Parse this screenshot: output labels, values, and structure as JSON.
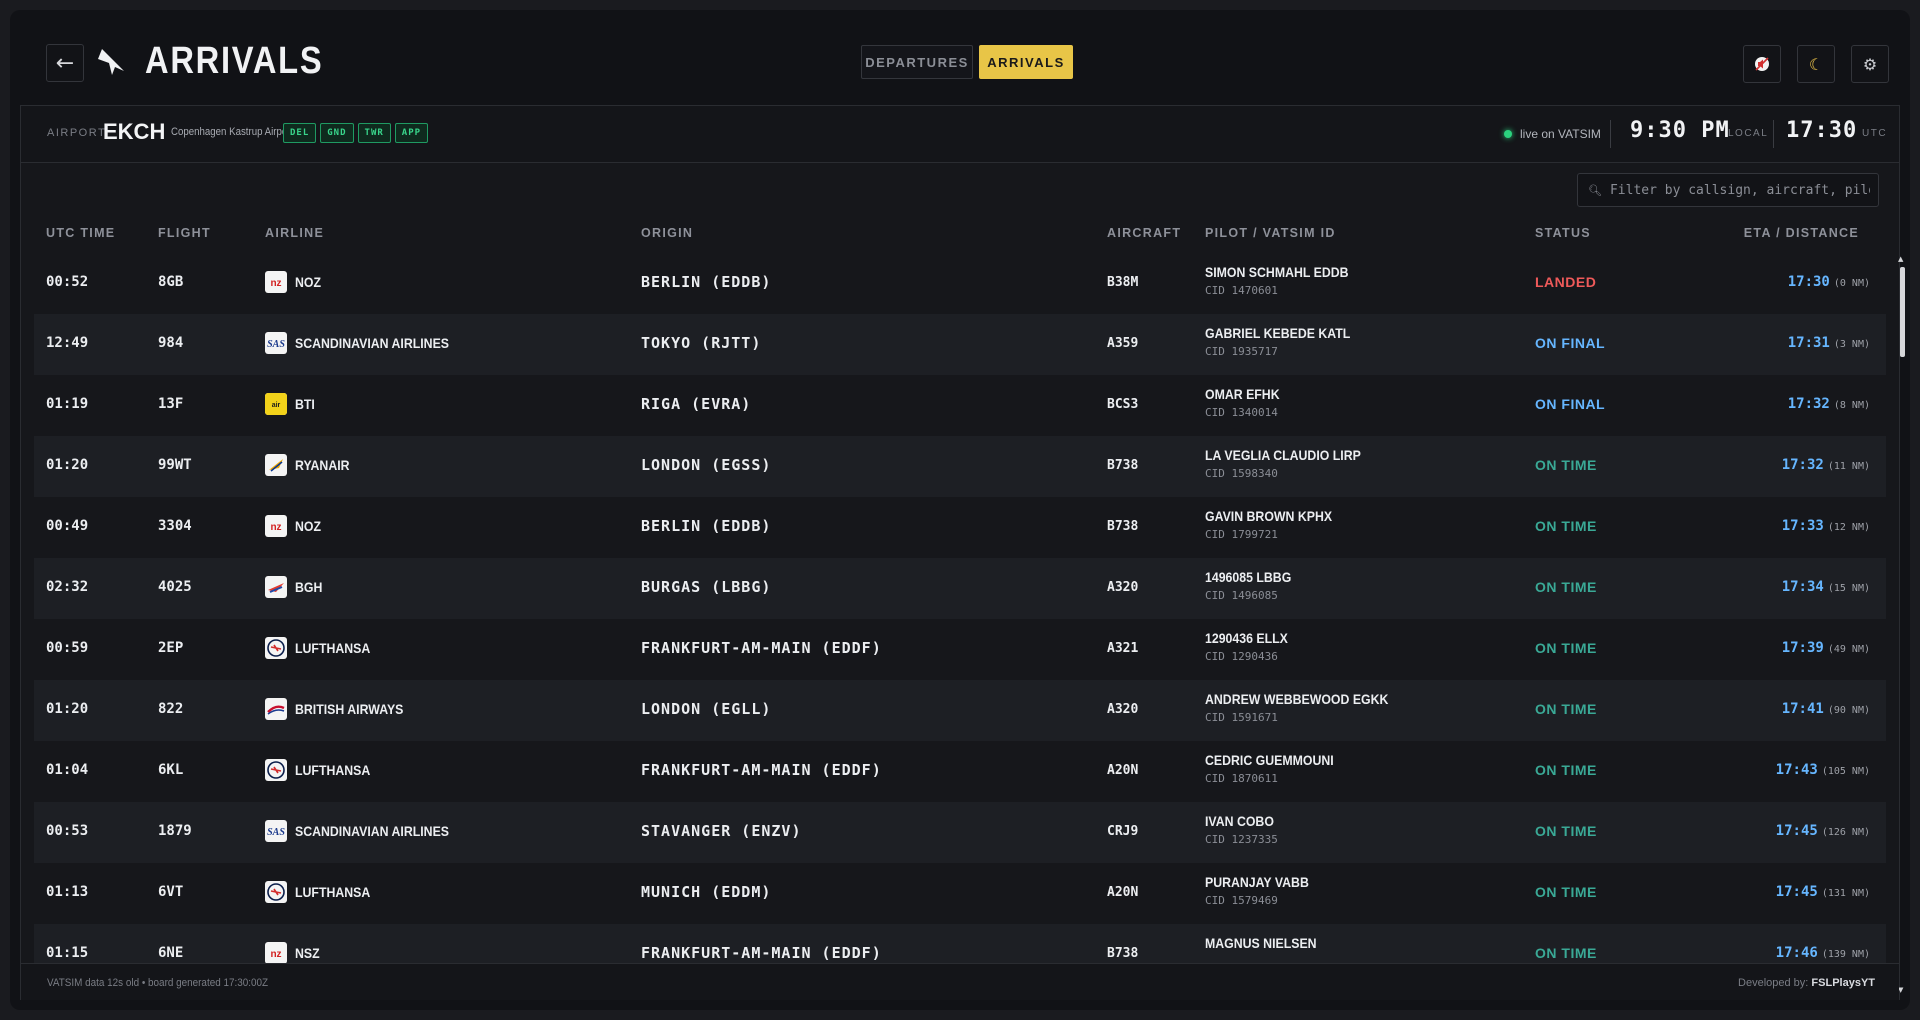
{
  "header": {
    "back_label": "←",
    "title": "ARRIVALS",
    "tabs": [
      {
        "label": "DEPARTURES",
        "active": false
      },
      {
        "label": "ARRIVALS",
        "active": true
      }
    ],
    "icons": [
      "mute-icon",
      "moon-icon",
      "gear-icon"
    ]
  },
  "airport": {
    "label": "AIRPORT",
    "code": "EKCH",
    "name": "Copenhagen Kastrup Airport",
    "atc": [
      "DEL",
      "GND",
      "TWR",
      "APP"
    ],
    "live_text": "live on VATSIM",
    "local_time": "9:30 PM",
    "local_label": "LOCAL",
    "utc_time": "17:30",
    "utc_label": "UTC"
  },
  "filter": {
    "placeholder": "Filter by callsign, aircraft, pilot"
  },
  "columns": [
    "UTC TIME",
    "FLIGHT",
    "AIRLINE",
    "ORIGIN",
    "AIRCRAFT",
    "PILOT / VATSIM ID",
    "STATUS",
    "ETA / DISTANCE"
  ],
  "rows": [
    {
      "time": "00:52",
      "flight": "8GB",
      "airline": "NOZ",
      "logo": "noz",
      "origin": "BERLIN (EDDB)",
      "aircraft": "B38M",
      "pilot": "SIMON SCHMAHL EDDB",
      "cid": "CID 1470601",
      "status": "LANDED",
      "status_type": "landed",
      "eta": "17:30",
      "dist": "(0 NM)"
    },
    {
      "time": "12:49",
      "flight": "984",
      "airline": "SCANDINAVIAN AIRLINES",
      "logo": "sas",
      "origin": "TOKYO (RJTT)",
      "aircraft": "A359",
      "pilot": "GABRIEL KEBEDE KATL",
      "cid": "CID 1935717",
      "status": "ON FINAL",
      "status_type": "final",
      "eta": "17:31",
      "dist": "(3 NM)"
    },
    {
      "time": "01:19",
      "flight": "13F",
      "airline": "BTI",
      "logo": "bti",
      "origin": "RIGA (EVRA)",
      "aircraft": "BCS3",
      "pilot": "OMAR EFHK",
      "cid": "CID 1340014",
      "status": "ON FINAL",
      "status_type": "final",
      "eta": "17:32",
      "dist": "(8 NM)"
    },
    {
      "time": "01:20",
      "flight": "99WT",
      "airline": "RYANAIR",
      "logo": "ryanair",
      "origin": "LONDON (EGSS)",
      "aircraft": "B738",
      "pilot": "LA VEGLIA CLAUDIO LIRP",
      "cid": "CID 1598340",
      "status": "ON TIME",
      "status_type": "ontime",
      "eta": "17:32",
      "dist": "(11 NM)"
    },
    {
      "time": "00:49",
      "flight": "3304",
      "airline": "NOZ",
      "logo": "noz",
      "origin": "BERLIN (EDDB)",
      "aircraft": "B738",
      "pilot": "GAVIN BROWN KPHX",
      "cid": "CID 1799721",
      "status": "ON TIME",
      "status_type": "ontime",
      "eta": "17:33",
      "dist": "(12 NM)"
    },
    {
      "time": "02:32",
      "flight": "4025",
      "airline": "BGH",
      "logo": "bgh",
      "origin": "BURGAS (LBBG)",
      "aircraft": "A320",
      "pilot": "1496085 LBBG",
      "cid": "CID 1496085",
      "status": "ON TIME",
      "status_type": "ontime",
      "eta": "17:34",
      "dist": "(15 NM)"
    },
    {
      "time": "00:59",
      "flight": "2EP",
      "airline": "LUFTHANSA",
      "logo": "lufthansa",
      "origin": "FRANKFURT-AM-MAIN (EDDF)",
      "aircraft": "A321",
      "pilot": "1290436 ELLX",
      "cid": "CID 1290436",
      "status": "ON TIME",
      "status_type": "ontime",
      "eta": "17:39",
      "dist": "(49 NM)"
    },
    {
      "time": "01:20",
      "flight": "822",
      "airline": "BRITISH AIRWAYS",
      "logo": "ba",
      "origin": "LONDON (EGLL)",
      "aircraft": "A320",
      "pilot": "ANDREW WEBBEWOOD EGKK",
      "cid": "CID 1591671",
      "status": "ON TIME",
      "status_type": "ontime",
      "eta": "17:41",
      "dist": "(90 NM)"
    },
    {
      "time": "01:04",
      "flight": "6KL",
      "airline": "LUFTHANSA",
      "logo": "lufthansa",
      "origin": "FRANKFURT-AM-MAIN (EDDF)",
      "aircraft": "A20N",
      "pilot": "CEDRIC GUEMMOUNI",
      "cid": "CID 1870611",
      "status": "ON TIME",
      "status_type": "ontime",
      "eta": "17:43",
      "dist": "(105 NM)"
    },
    {
      "time": "00:53",
      "flight": "1879",
      "airline": "SCANDINAVIAN AIRLINES",
      "logo": "sas",
      "origin": "STAVANGER (ENZV)",
      "aircraft": "CRJ9",
      "pilot": "IVAN COBO",
      "cid": "CID 1237335",
      "status": "ON TIME",
      "status_type": "ontime",
      "eta": "17:45",
      "dist": "(126 NM)"
    },
    {
      "time": "01:13",
      "flight": "6VT",
      "airline": "LUFTHANSA",
      "logo": "lufthansa",
      "origin": "MUNICH (EDDM)",
      "aircraft": "A20N",
      "pilot": "PURANJAY VABB",
      "cid": "CID 1579469",
      "status": "ON TIME",
      "status_type": "ontime",
      "eta": "17:45",
      "dist": "(131 NM)"
    },
    {
      "time": "01:15",
      "flight": "6NE",
      "airline": "NSZ",
      "logo": "noz",
      "origin": "FRANKFURT-AM-MAIN (EDDF)",
      "aircraft": "B738",
      "pilot": "MAGNUS NIELSEN",
      "cid": "",
      "status": "ON TIME",
      "status_type": "ontime",
      "eta": "17:46",
      "dist": "(139 NM)"
    }
  ],
  "footer": {
    "left": "VATSIM data 12s old • board generated 17:30:00Z",
    "right_prefix": "Developed by:",
    "right_name": "FSLPlaysYT"
  },
  "colors": {
    "accent": "#e8c547",
    "landed": "#ef5a5a",
    "final": "#66b6ff",
    "ontime": "#3aa996",
    "atc": "#39d58b"
  }
}
